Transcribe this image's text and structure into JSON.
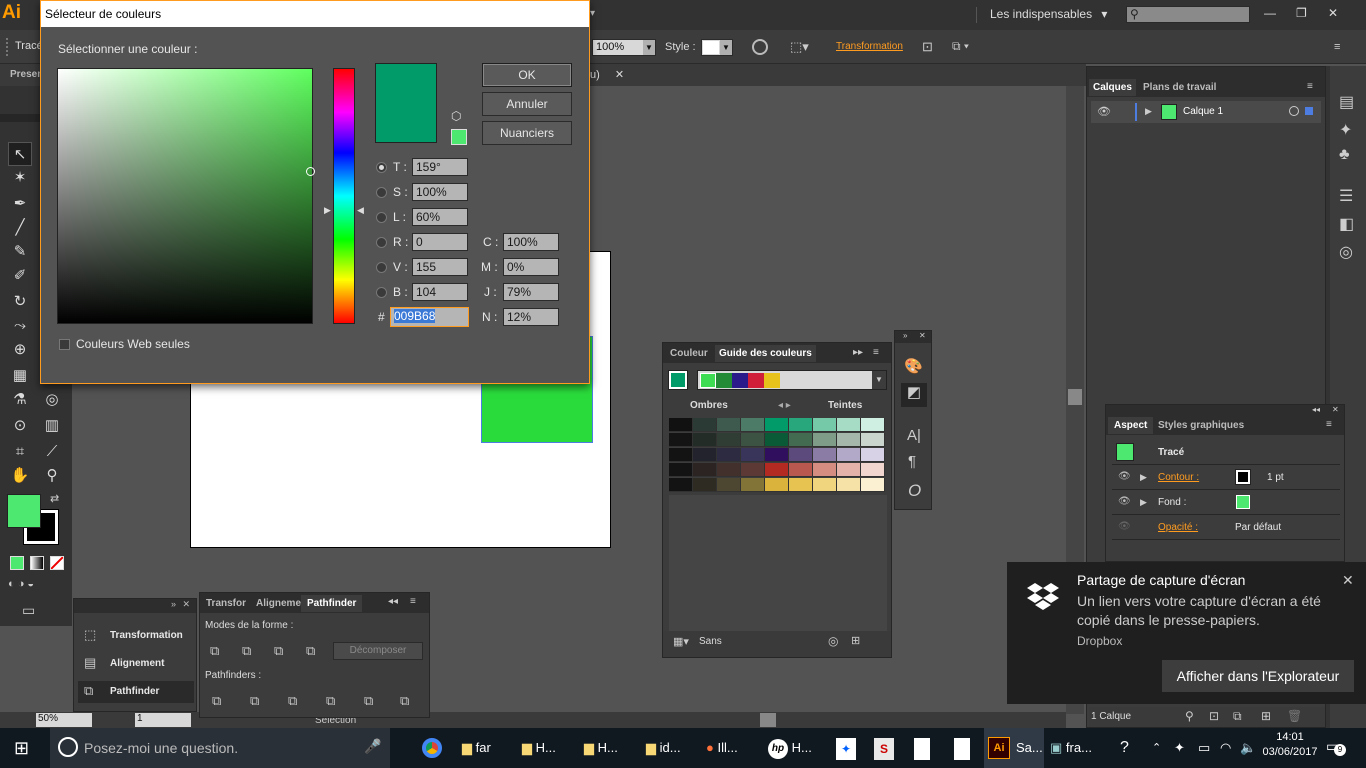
{
  "app": {
    "logo": "Ai",
    "workspace": "Les indispensables",
    "workspace_arrow": "▾",
    "search_placeholder": "",
    "window_buttons": [
      "—",
      "❐",
      "✕"
    ]
  },
  "control_bar": {
    "left_label": "Tracé",
    "zoom": "100%",
    "style_label": "Style :",
    "transformation": "Transformation"
  },
  "tabs": {
    "left": "Presen",
    "doc_suffix": "u)",
    "doc_close": "✕"
  },
  "dialog": {
    "title": "Sélecteur de couleurs",
    "prompt": "Sélectionner une couleur :",
    "current_color": "#009B68",
    "ok": "OK",
    "cancel": "Annuler",
    "swatches": "Nuanciers",
    "web_only": "Couleurs Web seules",
    "fields": {
      "t_label": "T :",
      "t_value": "159°",
      "s_label": "S :",
      "s_value": "100%",
      "l_label": "L :",
      "l_value": "60%",
      "r_label": "R :",
      "r_value": "0",
      "v_label": "V :",
      "v_value": "155",
      "b_label": "B :",
      "b_value": "104",
      "hex_label": "#",
      "hex_value": "009B68",
      "c_label": "C :",
      "c_value": "100%",
      "m_label": "M :",
      "m_value": "0%",
      "j_label": "J :",
      "j_value": "79%",
      "n_label": "N :",
      "n_value": "12%"
    }
  },
  "layers_panel": {
    "tab_layers": "Calques",
    "tab_artboards": "Plans de travail",
    "layer_name": "Calque 1",
    "footer": "1 Calque"
  },
  "color_guide": {
    "tab_color": "Couleur",
    "tab_guide": "Guide des couleurs",
    "shades": "Ombres",
    "tints": "Teintes",
    "footer_label": "Sans",
    "harmony": [
      "#3ddc53",
      "#238a36",
      "#2a1a8a",
      "#cf1f39",
      "#e6c21a"
    ],
    "grid_colors": [
      [
        "#111",
        "#2b3a35",
        "#3e5a4f",
        "#4c7b68",
        "#009b68",
        "#28a67c",
        "#76c9a8",
        "#a6dbc5",
        "#d0efe3"
      ],
      [
        "#141414",
        "#232c27",
        "#2f3d34",
        "#3c5242",
        "#0b5a37",
        "#426b52",
        "#7e9c88",
        "#a4b7aa",
        "#cad6cd"
      ],
      [
        "#131313",
        "#22232c",
        "#2d2b42",
        "#393459",
        "#30105e",
        "#5c4a7c",
        "#8b7ca6",
        "#b2a8c7",
        "#d7d2e6"
      ],
      [
        "#131313",
        "#2c2422",
        "#42302d",
        "#5c3934",
        "#b22a22",
        "#b9584f",
        "#d58c81",
        "#e4b2a8",
        "#f1d6cf"
      ],
      [
        "#131313",
        "#2d2b22",
        "#4d4731",
        "#827337",
        "#d9b33b",
        "#e7c351",
        "#f0d57e",
        "#f6e2a6",
        "#fbf0d1"
      ]
    ]
  },
  "pathfinder_panel": {
    "tab_transform": "Transfor",
    "tab_align": "Aligneme",
    "tab_pathfinder": "Pathfinder",
    "shape_modes": "Modes de la forme :",
    "expand": "Décomposer",
    "pathfinders": "Pathfinders :"
  },
  "side_list": {
    "items": [
      "Transformation",
      "Alignement",
      "Pathfinder"
    ]
  },
  "appearance_panel": {
    "tab_aspect": "Aspect",
    "tab_styles": "Styles graphiques",
    "object": "Tracé",
    "stroke_label": "Contour :",
    "stroke_value": "1 pt",
    "fill_label": "Fond :",
    "opacity_label": "Opacité :",
    "opacity_value": "Par défaut"
  },
  "status_bar": {
    "zoom": "50%",
    "page": "1",
    "mode": "Sélection"
  },
  "toast": {
    "title": "Partage de capture d'écran",
    "message": "Un lien vers votre capture d'écran a été copié dans le presse-papiers.",
    "source": "Dropbox",
    "action": "Afficher dans l'Explorateur",
    "close": "✕"
  },
  "taskbar": {
    "search": "Posez-moi une question.",
    "items": [
      "far",
      "H...",
      "H...",
      "id...",
      "Ill...",
      "H...",
      "Sa...",
      "fra..."
    ],
    "time": "14:01",
    "date": "03/06/2017",
    "notification_count": "9"
  },
  "colors": {
    "fill_green": "#4ce870",
    "object_green": "#2adc3b",
    "accent_orange": "#ff9c20"
  }
}
